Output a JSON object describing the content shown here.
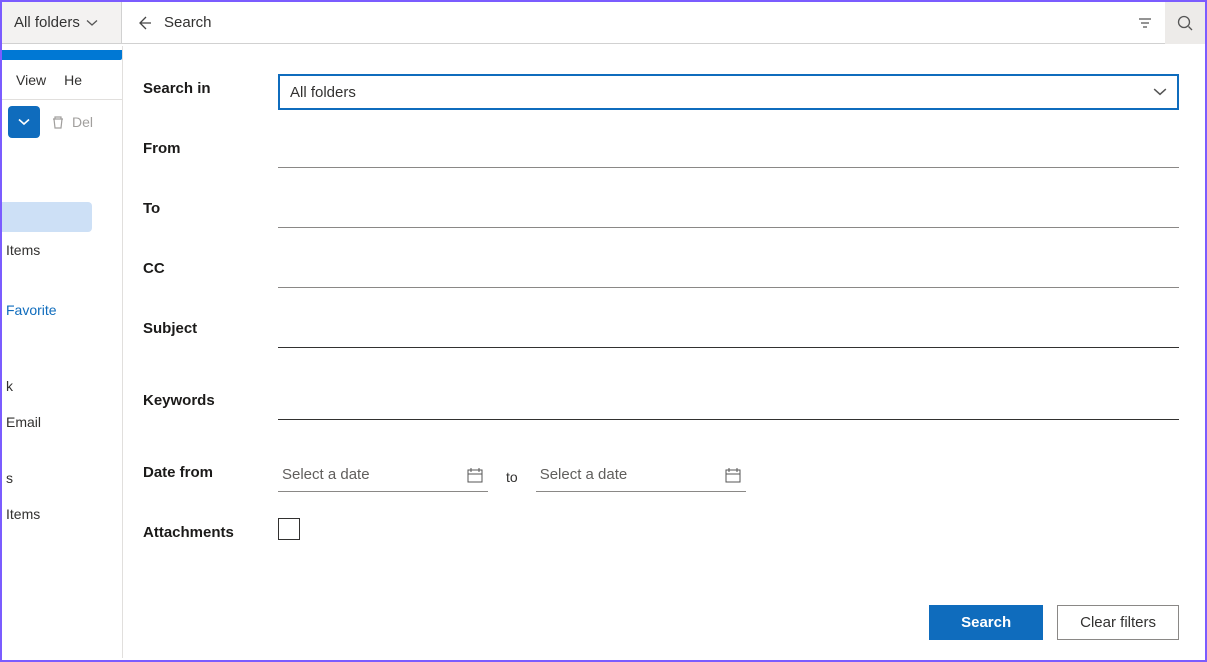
{
  "topbar": {
    "scope_label": "All folders",
    "search_text": "Search"
  },
  "back_tabs": {
    "view": "View",
    "help": "He"
  },
  "back_row2": {
    "delete": "Del"
  },
  "left_items": {
    "items": "Items",
    "favorite": "Favorite",
    "email": "Email",
    "small_s": "s",
    "small_k": "k",
    "items2": "Items"
  },
  "form": {
    "search_in_label": "Search in",
    "search_in_value": "All folders",
    "from_label": "From",
    "to_label": "To",
    "cc_label": "CC",
    "subject_label": "Subject",
    "keywords_label": "Keywords",
    "date_from_label": "Date from",
    "date_placeholder1": "Select a date",
    "date_to_word": "to",
    "date_placeholder2": "Select a date",
    "attachments_label": "Attachments"
  },
  "buttons": {
    "search": "Search",
    "clear": "Clear filters"
  }
}
